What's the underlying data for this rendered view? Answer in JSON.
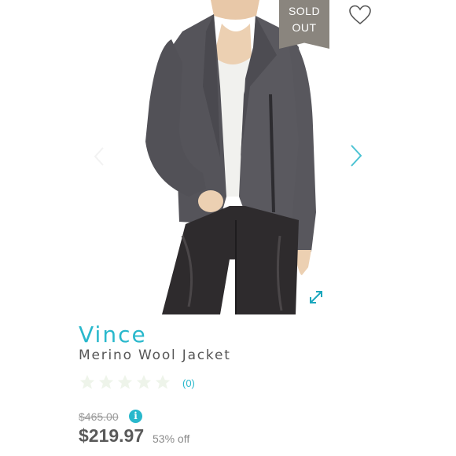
{
  "badge": {
    "line1": "SOLD",
    "line2": "OUT",
    "color": "#8a857e"
  },
  "product": {
    "brand": "Vince",
    "name": "Merino Wool Jacket",
    "rating_stars": 0,
    "rating_max": 5,
    "review_count": "(0)",
    "original_price": "$465.00",
    "sale_price": "$219.97",
    "discount": "53% off"
  },
  "icons": {
    "favorite": "heart-outline-icon",
    "next": "chevron-right-icon",
    "expand": "expand-arrows-icon",
    "info": "info-icon"
  },
  "info_glyph": "i",
  "colors": {
    "accent": "#29b8cc",
    "text": "#555555",
    "star_empty": "#eef4ea"
  }
}
